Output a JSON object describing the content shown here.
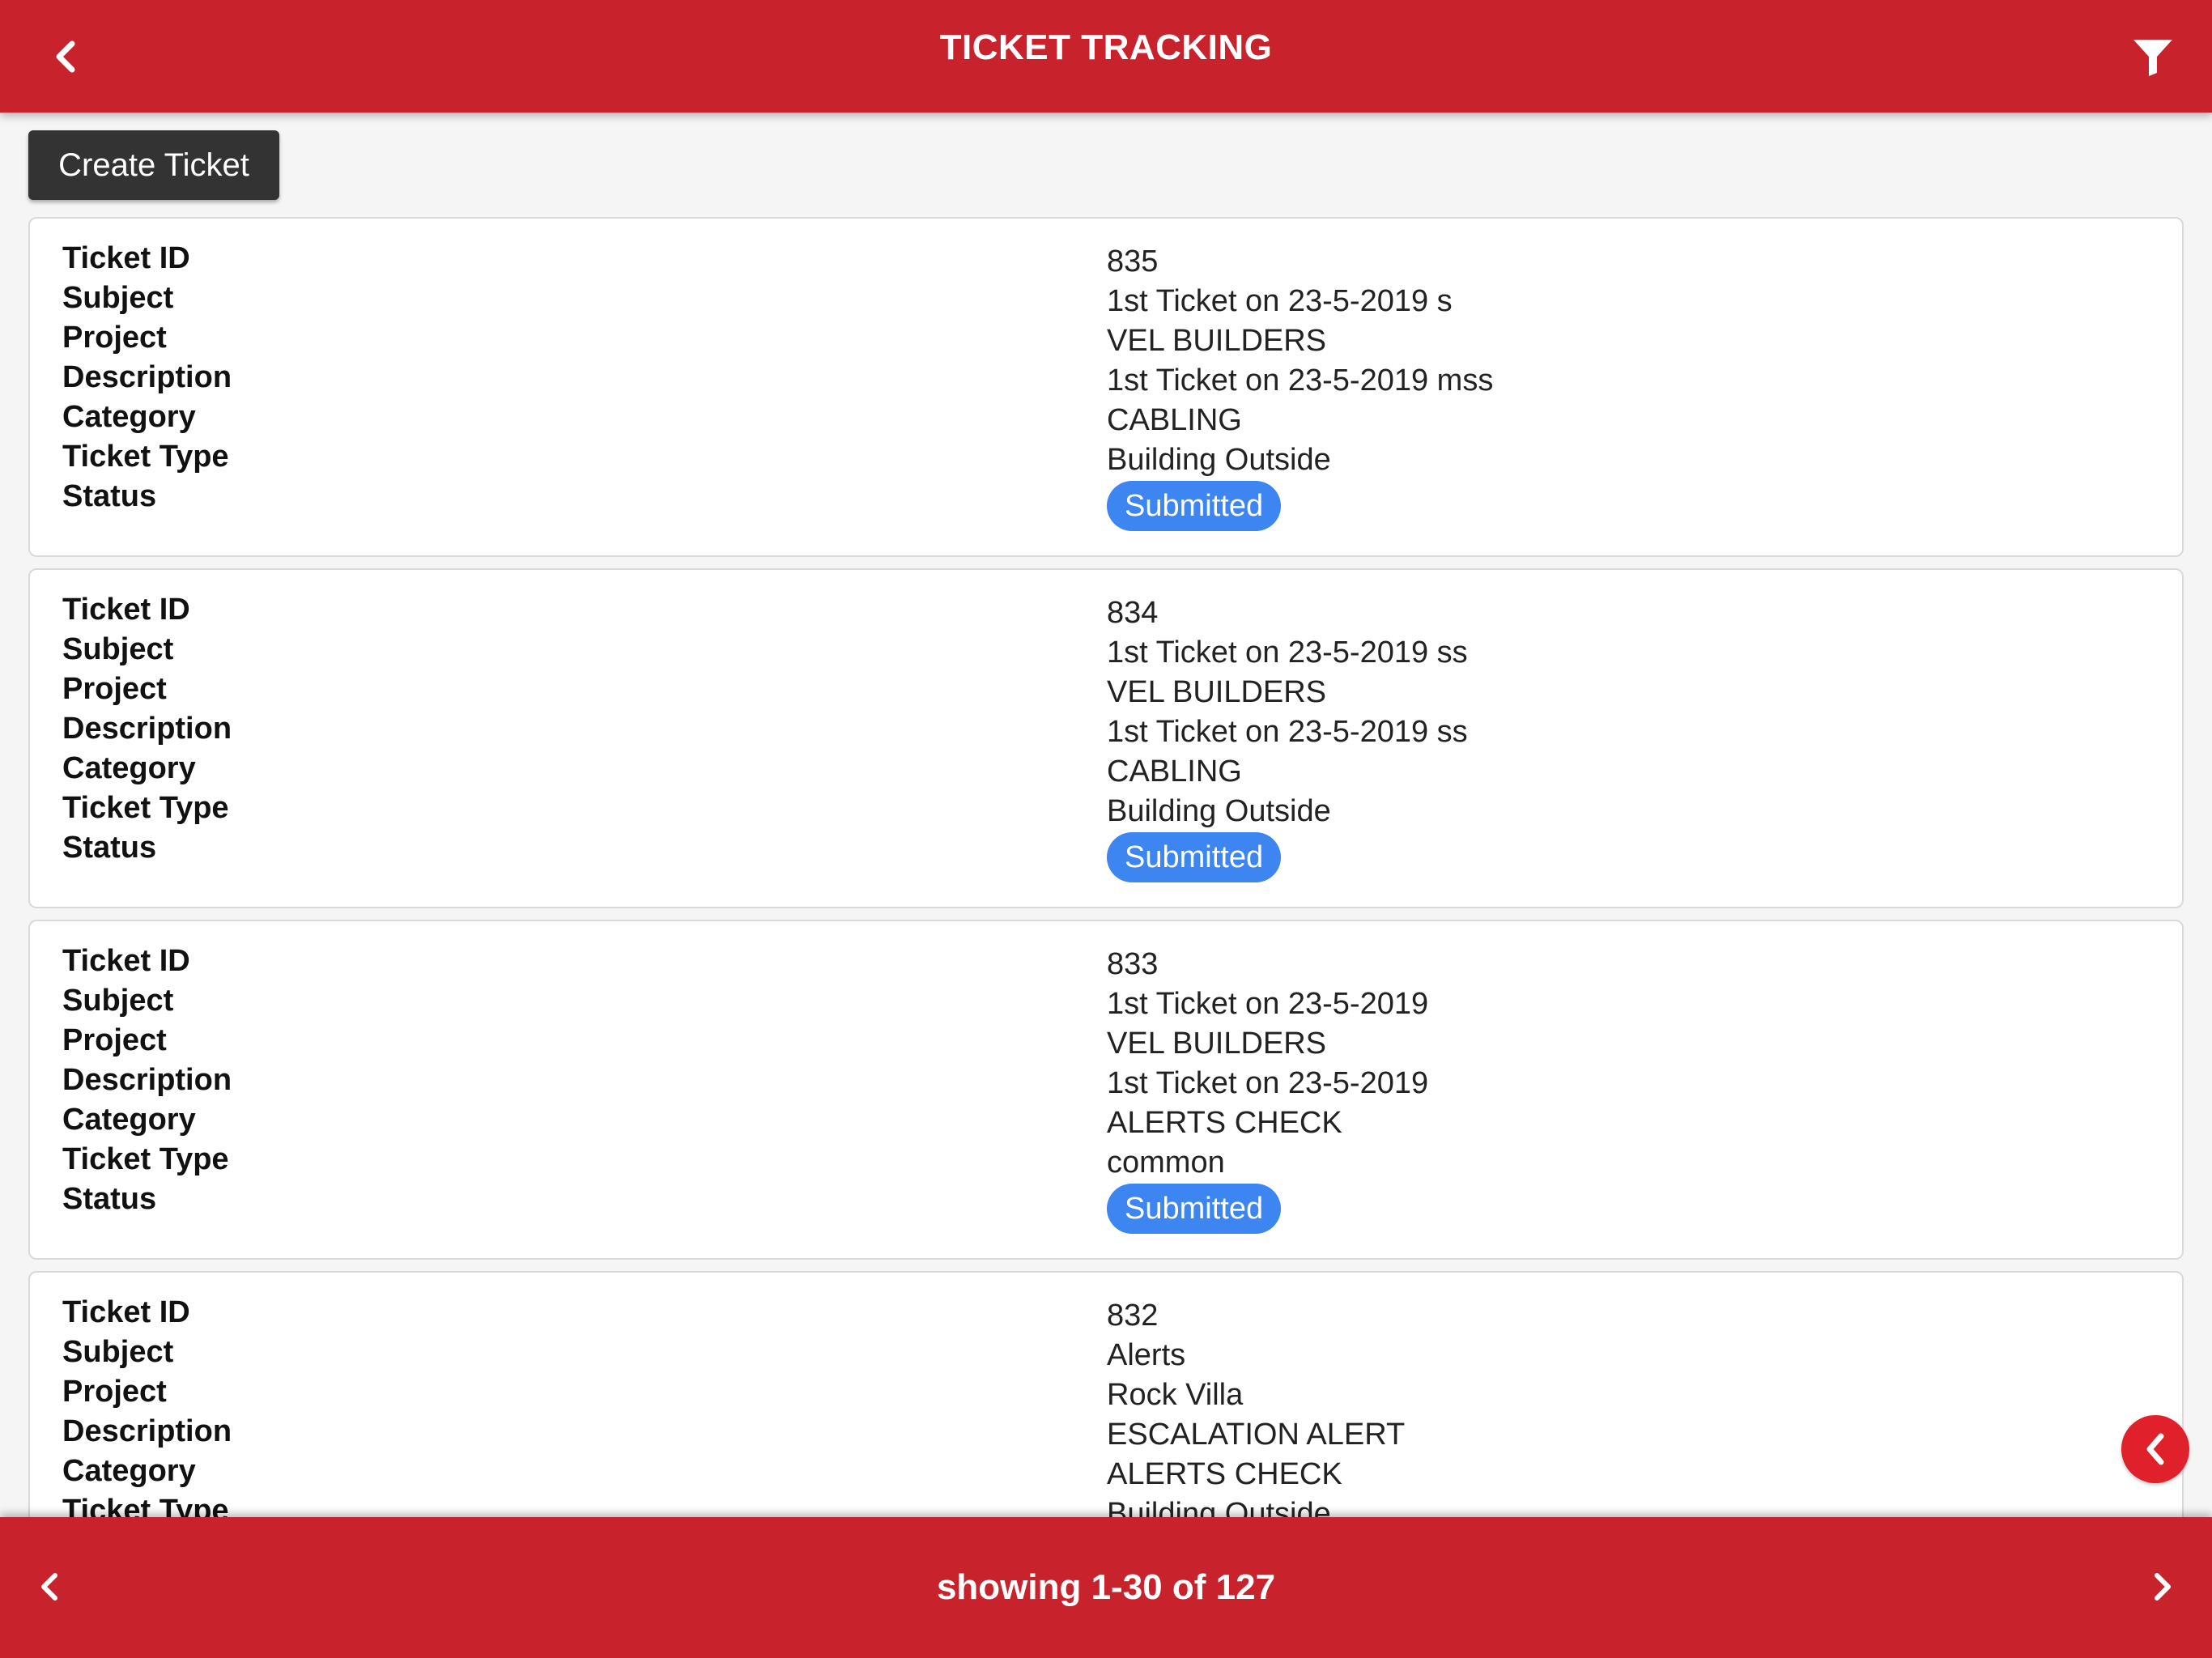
{
  "header": {
    "title": "TICKET TRACKING",
    "back_icon": "chevron-left-icon",
    "filter_icon": "filter-icon",
    "color": "#c8232c"
  },
  "toolbar": {
    "create_label": "Create Ticket"
  },
  "labels": {
    "ticket_id": "Ticket ID",
    "subject": "Subject",
    "project": "Project",
    "description": "Description",
    "category": "Category",
    "ticket_type": "Ticket Type",
    "status": "Status"
  },
  "tickets": [
    {
      "id": "835",
      "subject": "1st Ticket on 23-5-2019 s",
      "project": "VEL BUILDERS",
      "description": "1st Ticket on 23-5-2019 mss",
      "category": "CABLING",
      "ticket_type": "Building Outside",
      "status": "Submitted"
    },
    {
      "id": "834",
      "subject": "1st Ticket on 23-5-2019 ss",
      "project": "VEL BUILDERS",
      "description": "1st Ticket on 23-5-2019 ss",
      "category": "CABLING",
      "ticket_type": "Building Outside",
      "status": "Submitted"
    },
    {
      "id": "833",
      "subject": "1st Ticket on 23-5-2019",
      "project": "VEL BUILDERS",
      "description": "1st Ticket on 23-5-2019",
      "category": "ALERTS CHECK",
      "ticket_type": "common",
      "status": "Submitted"
    },
    {
      "id": "832",
      "subject": "Alerts",
      "project": "Rock Villa",
      "description": "ESCALATION ALERT",
      "category": "ALERTS CHECK",
      "ticket_type": "Building Outside",
      "status": ""
    }
  ],
  "status_color": "#3d86f2",
  "fab": {
    "icon": "chevron-left-icon"
  },
  "footer": {
    "pagination_text": "showing 1-30 of 127",
    "prev_icon": "chevron-left-icon",
    "next_icon": "chevron-right-icon"
  }
}
